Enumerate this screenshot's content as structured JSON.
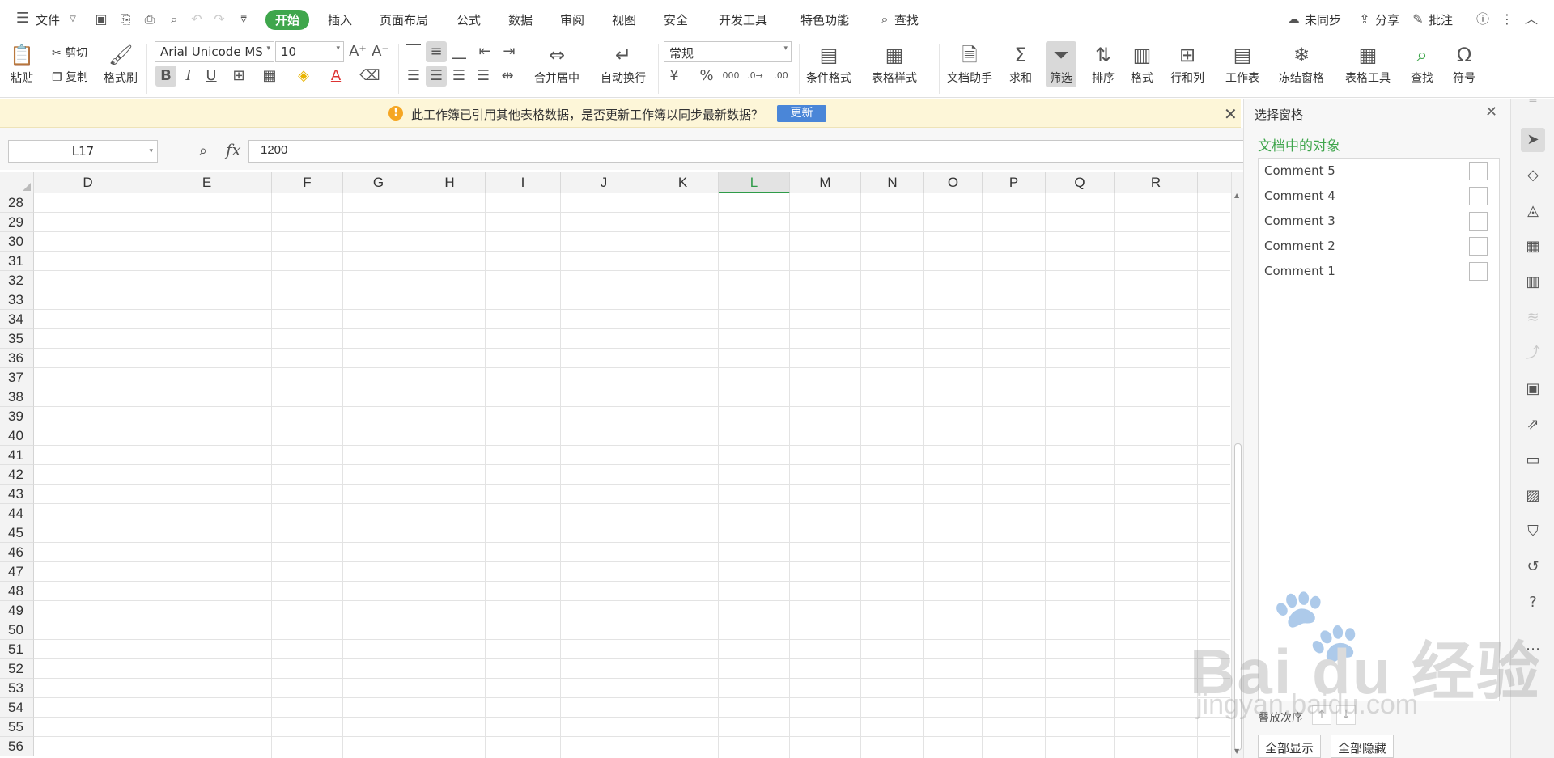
{
  "menubar": {
    "file_label": "文件",
    "tabs": [
      {
        "label": "开始"
      },
      {
        "label": "插入"
      },
      {
        "label": "页面布局"
      },
      {
        "label": "公式"
      },
      {
        "label": "数据"
      },
      {
        "label": "审阅"
      },
      {
        "label": "视图"
      },
      {
        "label": "安全"
      },
      {
        "label": "开发工具"
      },
      {
        "label": "特色功能"
      }
    ],
    "search_label": "查找",
    "sync_label": "未同步",
    "share_label": "分享",
    "comment_label": "批注"
  },
  "ribbon": {
    "paste": "粘贴",
    "cut": "剪切",
    "copy": "复制",
    "format_painter": "格式刷",
    "font_name": "Arial Unicode MS",
    "font_size": "10",
    "merge_center": "合并居中",
    "wrap_text": "自动换行",
    "number_format": "常规",
    "conditional_format": "条件格式",
    "table_style": "表格样式",
    "doc_assistant": "文档助手",
    "sum": "求和",
    "filter": "筛选",
    "sort": "排序",
    "format": "格式",
    "row_col": "行和列",
    "worksheet": "工作表",
    "freeze": "冻结窗格",
    "table_tools": "表格工具",
    "find": "查找",
    "symbol": "符号",
    "bold": "B",
    "italic": "I",
    "underline": "U"
  },
  "notice": {
    "text": "此工作簿已引用其他表格数据，是否更新工作簿以同步最新数据？",
    "update_button": "更新"
  },
  "formula_bar": {
    "cell_ref": "L17",
    "fx": "fx",
    "value": "1200"
  },
  "grid": {
    "columns": [
      "D",
      "E",
      "F",
      "G",
      "H",
      "I",
      "J",
      "K",
      "L",
      "M",
      "N",
      "O",
      "P",
      "Q",
      "R"
    ],
    "selected_column": "L",
    "rows": [
      "28",
      "29",
      "30",
      "31",
      "32",
      "33",
      "34",
      "35",
      "36",
      "37",
      "38",
      "39",
      "40",
      "41",
      "42",
      "43",
      "44",
      "45",
      "46",
      "47",
      "48",
      "49",
      "50",
      "51",
      "52",
      "53",
      "54",
      "55",
      "56"
    ]
  },
  "selection_pane": {
    "title": "选择窗格",
    "section": "文档中的对象",
    "objects": [
      {
        "name": "Comment 5"
      },
      {
        "name": "Comment 4"
      },
      {
        "name": "Comment 3"
      },
      {
        "name": "Comment 2"
      },
      {
        "name": "Comment 1"
      }
    ],
    "order_label": "叠放次序",
    "show_all": "全部显示",
    "hide_all": "全部隐藏"
  },
  "watermark": {
    "brand": "Bai du 经验",
    "url": "jingyan.baidu.com"
  },
  "colors": {
    "accent": "#3fa64c",
    "notice_bg": "#fdf6d8",
    "update_button": "#4a86d8"
  }
}
